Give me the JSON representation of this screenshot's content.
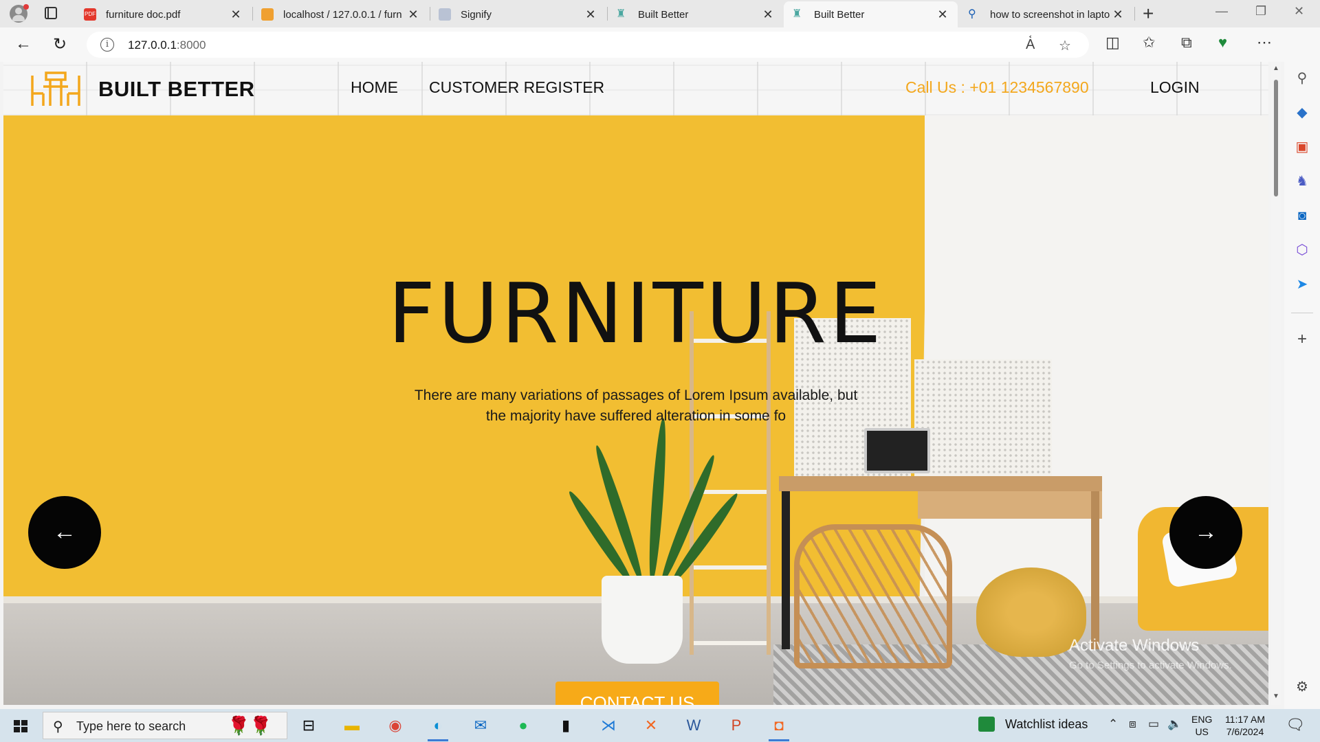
{
  "browser": {
    "tabs": [
      {
        "title": "furniture doc.pdf",
        "icon": "pdf-icon",
        "active": false
      },
      {
        "title": "localhost / 127.0.0.1 / furn",
        "icon": "phpmyadmin-icon",
        "active": false
      },
      {
        "title": "Signify",
        "icon": "signify-icon",
        "active": false
      },
      {
        "title": "Built Better",
        "icon": "chair-icon",
        "active": false
      },
      {
        "title": "Built Better",
        "icon": "chair-icon",
        "active": true
      },
      {
        "title": "how to screenshot in lapto",
        "icon": "search-icon",
        "active": false
      }
    ],
    "url_host": "127.0.0.1",
    "url_port": ":8000"
  },
  "site": {
    "brand": "BUILT BETTER",
    "nav": {
      "home": "HOME",
      "register": "CUSTOMER REGISTER",
      "login": "LOGIN"
    },
    "call_us": "Call Us : +01 1234567890",
    "accent_color": "#f3a71c",
    "hero": {
      "title": "FURNITURE",
      "subtitle_line1": "There are many variations of passages of Lorem Ipsum available, but",
      "subtitle_line2": "the majority have suffered alteration in some fo",
      "prev_label": "←",
      "next_label": "→",
      "cta": "CONTACT US"
    }
  },
  "watermark": {
    "line1": "Activate Windows",
    "line2": "Go to Settings to activate Windows."
  },
  "taskbar": {
    "search_placeholder": "Type here to search",
    "widget": "Watchlist ideas",
    "lang_top": "ENG",
    "lang_bottom": "US",
    "time": "11:17 AM",
    "date": "7/6/2024"
  }
}
